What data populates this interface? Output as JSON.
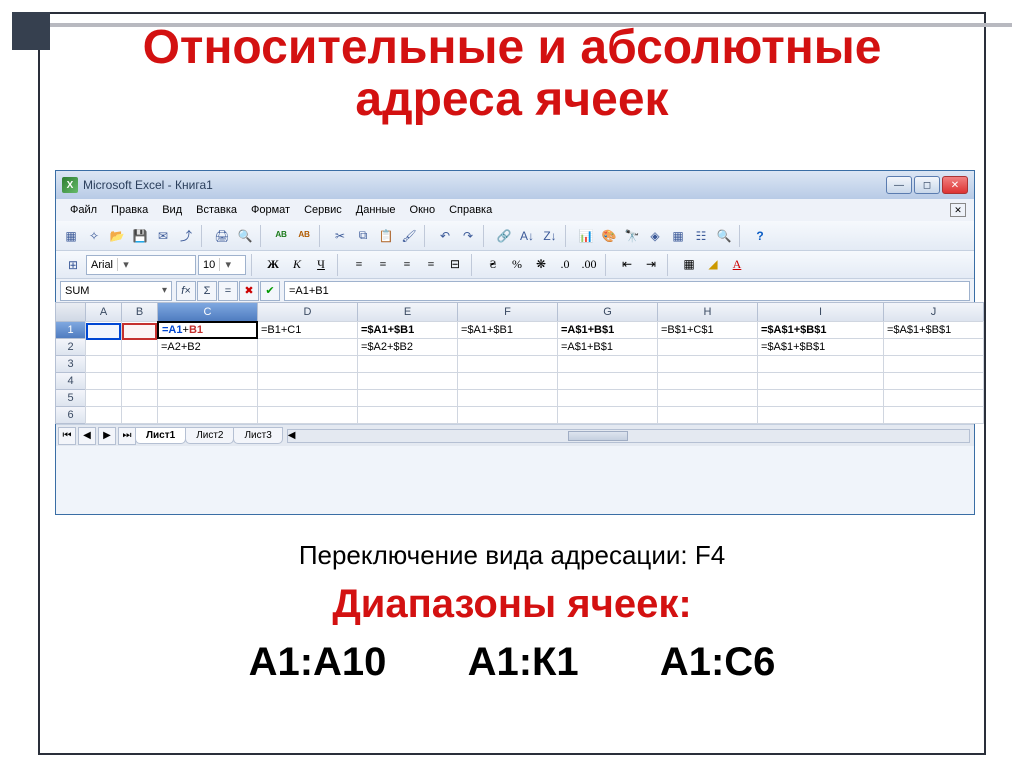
{
  "title_line1": "Относительные и абсолютные",
  "title_line2": "адреса ячеек",
  "window_title": "Microsoft Excel - Книга1",
  "menu": [
    "Файл",
    "Правка",
    "Вид",
    "Вставка",
    "Формат",
    "Сервис",
    "Данные",
    "Окно",
    "Справка"
  ],
  "format": {
    "font": "Arial",
    "size": "10"
  },
  "formula": {
    "namebox": "SUM",
    "content": "=A1+B1"
  },
  "columns": [
    "A",
    "B",
    "C",
    "D",
    "E",
    "F",
    "G",
    "H",
    "I",
    "J"
  ],
  "rows": [
    "1",
    "2",
    "3",
    "4",
    "5",
    "6"
  ],
  "cells": {
    "C1_a": "=A1",
    "C1_plus": "+",
    "C1_b": "B1",
    "D1": "=B1+C1",
    "E1": "=$A1+$B1",
    "F1": "=$A1+$B1",
    "G1": "=A$1+B$1",
    "H1": "=B$1+C$1",
    "I1": "=$A$1+$B$1",
    "J1": "=$A$1+$B$1",
    "C2": "=A2+B2",
    "E2": "=$A2+$B2",
    "G2": "=A$1+B$1",
    "I2": "=$A$1+$B$1"
  },
  "tabs": [
    "Лист1",
    "Лист2",
    "Лист3"
  ],
  "switch_text": "Переключение вида адресации:  F4",
  "ranges_title": "Диапазоны ячеек:",
  "ranges": [
    "А1:А10",
    "А1:К1",
    "А1:С6"
  ]
}
